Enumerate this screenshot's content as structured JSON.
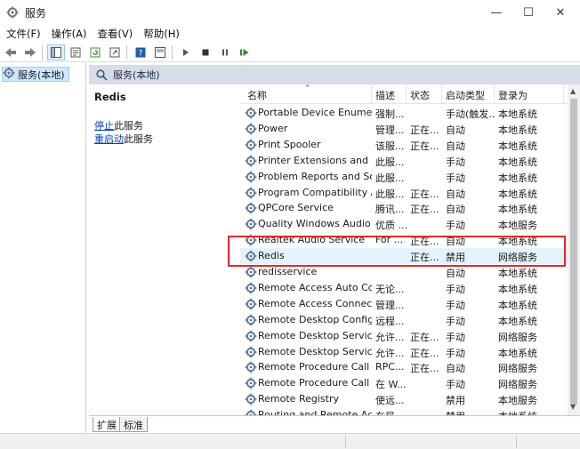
{
  "window": {
    "title": "服务",
    "minimize": "—",
    "maximize": "☐",
    "close": "✕"
  },
  "menu": [
    "文件(F)",
    "操作(A)",
    "查看(V)",
    "帮助(H)"
  ],
  "toolbar": {
    "buttons": [
      "back-icon",
      "forward-icon",
      "show-hide-tree-icon",
      "properties-icon",
      "refresh-icon",
      "export-icon",
      "help-icon",
      "console-icon",
      "start-icon",
      "stop-icon",
      "pause-icon",
      "restart-icon"
    ]
  },
  "tree": {
    "root_label": "服务(本地)"
  },
  "pane": {
    "header_label": "服务(本地)"
  },
  "detail": {
    "service_name": "Redis",
    "stop_link": "停止",
    "stop_suffix": "此服务",
    "restart_link": "重启动",
    "restart_suffix": "此服务"
  },
  "table": {
    "headers": {
      "name": "名称",
      "desc": "描述",
      "status": "状态",
      "start": "启动类型",
      "logon": "登录为"
    },
    "rows": [
      {
        "name": "Portable Device Enumera...",
        "desc": "强制...",
        "status": "",
        "start": "手动(触发...",
        "logon": "本地系统"
      },
      {
        "name": "Power",
        "desc": "管理...",
        "status": "正在...",
        "start": "自动",
        "logon": "本地系统"
      },
      {
        "name": "Print Spooler",
        "desc": "该服...",
        "status": "正在...",
        "start": "自动",
        "logon": "本地系统"
      },
      {
        "name": "Printer Extensions and N...",
        "desc": "此服...",
        "status": "",
        "start": "手动",
        "logon": "本地系统"
      },
      {
        "name": "Problem Reports and Sol...",
        "desc": "此服...",
        "status": "",
        "start": "手动",
        "logon": "本地系统"
      },
      {
        "name": "Program Compatibility A...",
        "desc": "此服...",
        "status": "正在...",
        "start": "自动",
        "logon": "本地系统"
      },
      {
        "name": "QPCore Service",
        "desc": "腾讯...",
        "status": "正在...",
        "start": "自动",
        "logon": "本地系统"
      },
      {
        "name": "Quality Windows Audio V...",
        "desc": "优质 ...",
        "status": "",
        "start": "手动",
        "logon": "本地服务"
      },
      {
        "name": "Realtek Audio Service",
        "desc": "For ...",
        "status": "正在...",
        "start": "自动",
        "logon": "本地系统"
      },
      {
        "name": "Redis",
        "desc": "",
        "status": "正在...",
        "start": "禁用",
        "logon": "网络服务"
      },
      {
        "name": "redisservice",
        "desc": "",
        "status": "",
        "start": "自动",
        "logon": "本地系统"
      },
      {
        "name": "Remote Access Auto Con...",
        "desc": "无论...",
        "status": "",
        "start": "手动",
        "logon": "本地系统"
      },
      {
        "name": "Remote Access Connecti...",
        "desc": "管理...",
        "status": "",
        "start": "手动",
        "logon": "本地系统"
      },
      {
        "name": "Remote Desktop Configu...",
        "desc": "远程...",
        "status": "",
        "start": "手动",
        "logon": "本地系统"
      },
      {
        "name": "Remote Desktop Services",
        "desc": "允许...",
        "status": "正在...",
        "start": "手动",
        "logon": "网络服务"
      },
      {
        "name": "Remote Desktop Service...",
        "desc": "允许...",
        "status": "正在...",
        "start": "手动",
        "logon": "本地系统"
      },
      {
        "name": "Remote Procedure Call (...",
        "desc": "RPC...",
        "status": "正在...",
        "start": "自动",
        "logon": "网络服务"
      },
      {
        "name": "Remote Procedure Call (...",
        "desc": "在 W...",
        "status": "",
        "start": "手动",
        "logon": "网络服务"
      },
      {
        "name": "Remote Registry",
        "desc": "使远...",
        "status": "",
        "start": "禁用",
        "logon": "本地服务"
      },
      {
        "name": "Routing and Remote Acc...",
        "desc": "在局...",
        "status": "",
        "start": "禁用",
        "logon": "本地系统"
      }
    ]
  },
  "tabs": [
    "扩展",
    "标准"
  ],
  "colors": {
    "highlight_border": "#e8262b",
    "header_bg": "#d7dde7",
    "link": "#0645ad"
  }
}
